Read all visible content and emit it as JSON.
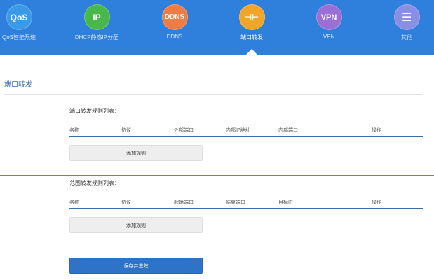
{
  "nav": {
    "items": [
      {
        "icon_text": "QoS",
        "label": "QoS智能限速",
        "color": "#3a9ae8",
        "icon": "qos-icon"
      },
      {
        "icon_text": "IP",
        "label": "DHCP静态IP分配",
        "color": "#48b84a",
        "icon": "ip-icon"
      },
      {
        "icon_text": "DDNS",
        "label": "DDNS",
        "color": "#ef7b45",
        "icon": "ddns-icon"
      },
      {
        "icon_text": "⊣⊢",
        "label": "端口转发",
        "color": "#f3a52b",
        "icon": "port-forward-icon",
        "active": true
      },
      {
        "icon_text": "VPN",
        "label": "VPN",
        "color": "#9a6fd6",
        "icon": "vpn-icon"
      },
      {
        "icon_text": "☰",
        "label": "其他",
        "color": "#8a8fe6",
        "icon": "menu-icon"
      }
    ],
    "background": "#2f7fdc"
  },
  "page": {
    "title": "端口转发"
  },
  "port_rules": {
    "title": "端口转发规则列表：",
    "columns": [
      "名称",
      "协议",
      "外部端口",
      "内部IP地址",
      "内部端口",
      "操作"
    ],
    "add_label": "添加规则"
  },
  "range_rules": {
    "title": "范围转发规则列表：",
    "columns": [
      "名称",
      "协议",
      "起始端口",
      "结束端口",
      "目标IP",
      "操作"
    ],
    "add_label": "添加规则"
  },
  "actions": {
    "save_label": "保存并生效"
  }
}
